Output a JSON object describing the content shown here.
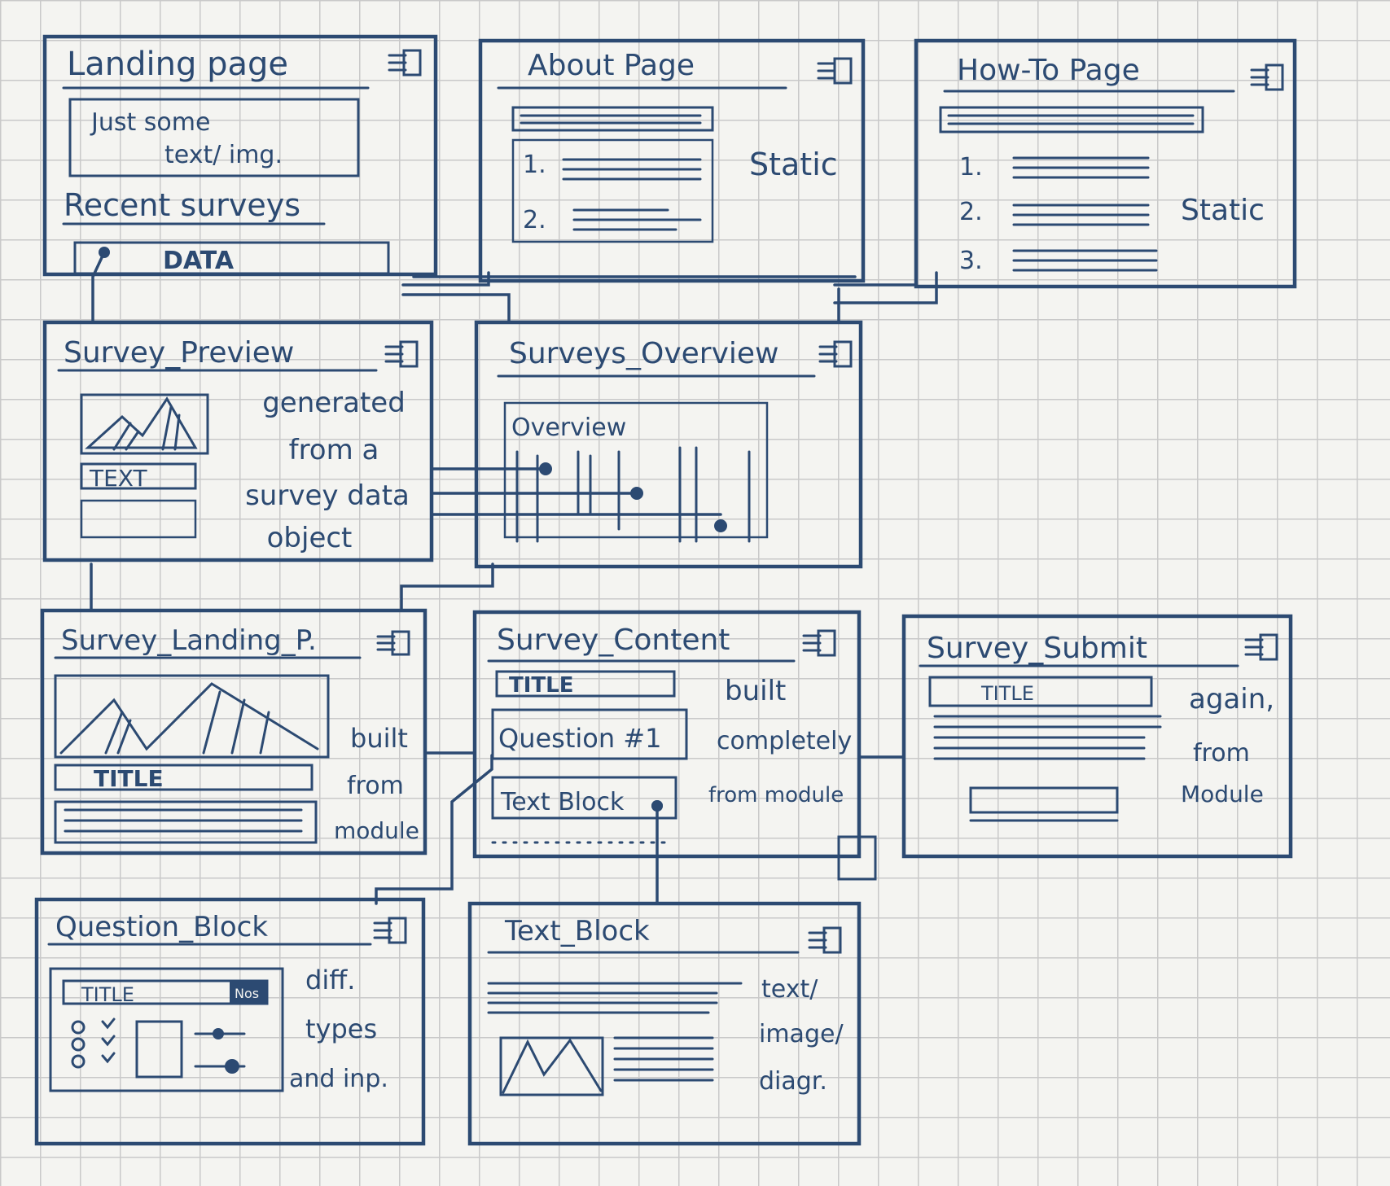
{
  "ink_color": "#2c4a72",
  "paper_color": "#f4f4f1",
  "grid_color": "#c9c9c9",
  "menu_icon": "hamburger-menu-icon",
  "landing": {
    "title": "Landing page",
    "box_text_1": "Just some",
    "box_text_2": "text/ img.",
    "section": "Recent surveys",
    "data_label": "DATA"
  },
  "about": {
    "title": "About Page",
    "list": [
      "1.",
      "2."
    ],
    "note": "Static"
  },
  "howto": {
    "title": "How-To Page",
    "list": [
      "1.",
      "2.",
      "3."
    ],
    "note": "Static"
  },
  "preview": {
    "title": "Survey_Preview",
    "text_label": "TEXT",
    "note": [
      "generated",
      "from a",
      "survey data",
      "object"
    ]
  },
  "overview": {
    "title": "Surveys_Overview",
    "label": "Overview"
  },
  "survey_landing": {
    "title": "Survey_Landing_P.",
    "title_label": "TITLE",
    "note": [
      "built",
      "from",
      "module"
    ]
  },
  "content": {
    "title": "Survey_Content",
    "title_label": "TITLE",
    "question": "Question #1",
    "text_block": "Text Block",
    "note": [
      "built",
      "completely",
      "from module"
    ]
  },
  "submit": {
    "title": "Survey_Submit",
    "title_label": "TITLE",
    "note": [
      "again,",
      "from",
      "Module"
    ]
  },
  "question_block": {
    "title": "Question_Block",
    "title_label": "TITLE",
    "badge": "Nos",
    "note": [
      "diff.",
      "types",
      "and inp."
    ]
  },
  "text_block": {
    "title": "Text_Block",
    "note": [
      "text/",
      "image/",
      "diagr."
    ]
  }
}
